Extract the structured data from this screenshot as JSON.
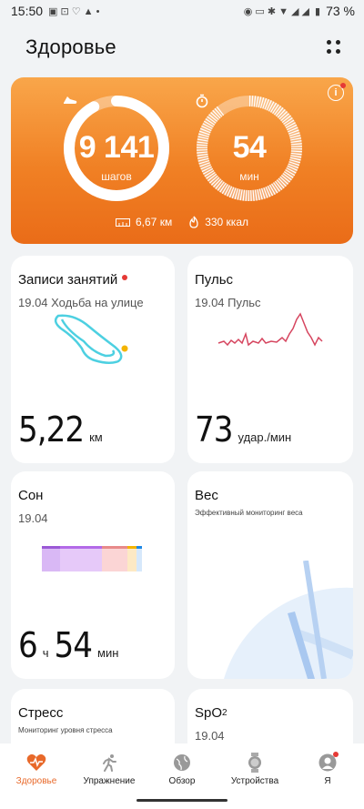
{
  "status_bar": {
    "time": "15:50",
    "battery": "73 %"
  },
  "header": {
    "title": "Здоровье"
  },
  "hero": {
    "steps_value": "9 141",
    "steps_unit": "шагов",
    "steps_progress": 0.92,
    "time_value": "54",
    "time_unit": "мин",
    "time_progress": 0.9,
    "distance": "6,67 км",
    "calories": "330 ккал",
    "accent": "#f08024"
  },
  "cards": {
    "activity": {
      "title": "Записи занятий",
      "subtitle": "19.04 Ходьба на улице",
      "value": "5,22",
      "unit": "км"
    },
    "pulse": {
      "title": "Пульс",
      "subtitle": "19.04 Пульс",
      "value": "73",
      "unit": "удар./мин"
    },
    "sleep": {
      "title": "Сон",
      "subtitle": "19.04",
      "hours": "6",
      "hours_unit": "ч",
      "minutes": "54",
      "minutes_unit": "мин"
    },
    "weight": {
      "title": "Вес",
      "subtitle": "Эффективный мониторинг веса"
    },
    "stress": {
      "title": "Стресс",
      "subtitle": "Мониторинг уровня стресса"
    },
    "spo2": {
      "title": "SpO",
      "title_sub": "2",
      "subtitle": "19.04"
    }
  },
  "tabbar": {
    "items": [
      {
        "label": "Здоровье",
        "icon": "heart-pulse-icon",
        "active": true
      },
      {
        "label": "Упражнение",
        "icon": "runner-icon",
        "active": false
      },
      {
        "label": "Обзор",
        "icon": "globe-icon",
        "active": false
      },
      {
        "label": "Устройства",
        "icon": "watch-icon",
        "active": false
      },
      {
        "label": "Я",
        "icon": "person-icon",
        "active": false
      }
    ]
  }
}
